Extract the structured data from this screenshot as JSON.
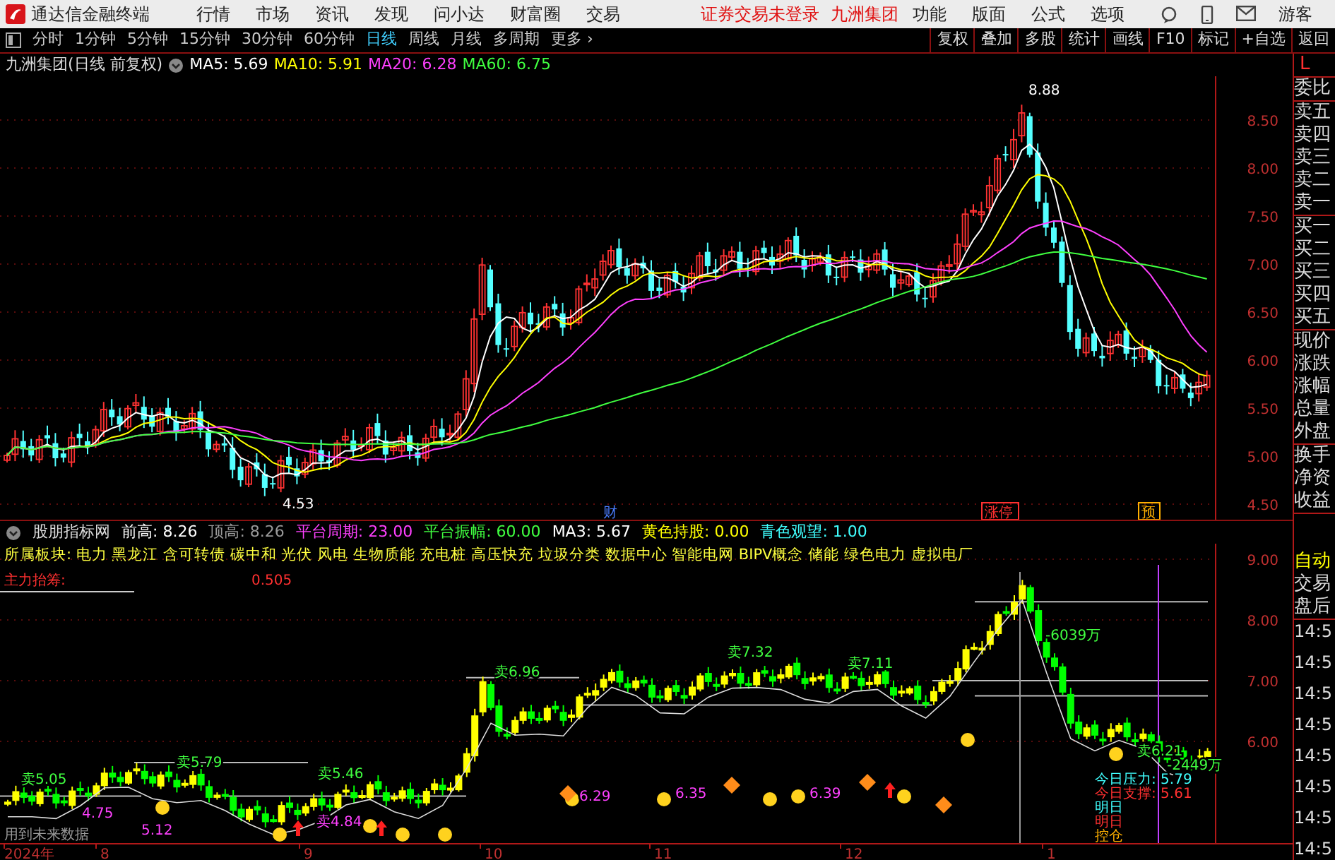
{
  "app_bar": {
    "title": "通达信金融终端",
    "menus": [
      "行情",
      "市场",
      "资讯",
      "发现",
      "问小达",
      "财富圈",
      "交易"
    ],
    "notice": "证券交易未登录",
    "stock": "九洲集团",
    "right_menus": [
      "功能",
      "版面",
      "公式",
      "选项"
    ],
    "user": "游客"
  },
  "period_bar": {
    "periods": [
      {
        "label": "分时",
        "selected": false
      },
      {
        "label": "1分钟",
        "selected": false
      },
      {
        "label": "5分钟",
        "selected": false
      },
      {
        "label": "15分钟",
        "selected": false
      },
      {
        "label": "30分钟",
        "selected": false
      },
      {
        "label": "60分钟",
        "selected": false
      },
      {
        "label": "日线",
        "selected": true
      },
      {
        "label": "周线",
        "selected": false
      },
      {
        "label": "月线",
        "selected": false
      },
      {
        "label": "多周期",
        "selected": false
      },
      {
        "label": "更多 ›",
        "selected": false
      }
    ],
    "tools": [
      "复权",
      "叠加",
      "多股",
      "统计",
      "画线",
      "F10",
      "标记",
      "+自选",
      "返回"
    ]
  },
  "chart_header": {
    "title": "九洲集团(日线 前复权)",
    "averages": [
      {
        "label": "MA5:",
        "value": "5.69",
        "color": "#ffffff"
      },
      {
        "label": "MA10:",
        "value": "5.91",
        "color": "#ffff00"
      },
      {
        "label": "MA20:",
        "value": "6.28",
        "color": "#ff40ff"
      },
      {
        "label": "MA60:",
        "value": "6.75",
        "color": "#40ff40"
      }
    ]
  },
  "price_chart": {
    "axis_labels": [
      "8.50",
      "8.00",
      "7.50",
      "7.00",
      "6.50",
      "6.00",
      "5.50",
      "5.00",
      "4.50"
    ],
    "annotations": [
      {
        "text": "8.88",
        "kind": "plain",
        "color": "#ffffff"
      },
      {
        "text": "4.53",
        "kind": "plain",
        "color": "#ffffff"
      },
      {
        "text": "财",
        "kind": "plain",
        "color": "#4a7dff"
      },
      {
        "text": "涨停",
        "kind": "tag",
        "color": "#ff3030"
      },
      {
        "text": "预",
        "kind": "tag",
        "color": "#ffb000"
      }
    ]
  },
  "indicator": {
    "name": "股朋指标网",
    "stats": [
      {
        "label": "前高:",
        "value": "8.26",
        "color": "#ffffff"
      },
      {
        "label": "顶高:",
        "value": "8.26",
        "color": "#9a9a9a"
      },
      {
        "label": "平台周期:",
        "value": "23.00",
        "color": "#ff40ff"
      },
      {
        "label": "平台振幅:",
        "value": "60.00",
        "color": "#40ff40"
      },
      {
        "label": "MA3:",
        "value": "5.67",
        "color": "#ffffff"
      },
      {
        "label": "黄色持股:",
        "value": "0.00",
        "color": "#ffff00"
      },
      {
        "label": "青色观望:",
        "value": "1.00",
        "color": "#40ffff"
      }
    ],
    "sectors": "所属板块: 电力 黑龙江 含可转债 碳中和 光伏 风电 生物质能 充电桩 高压快充 垃圾分类 数据中心 智能电网 BIPV概念 储能 绿色电力 虚拟电厂",
    "axis_labels": [
      "9.00",
      "8.00",
      "7.00",
      "6.00"
    ],
    "annotations": [
      {
        "text": "主力抬筹:",
        "color": "#ff3030"
      },
      {
        "text": "卖5.05",
        "color": "#40ff40"
      },
      {
        "text": "4.75",
        "color": "#ff40ff"
      },
      {
        "text": "用到未来数据",
        "color": "#9a9a9a"
      },
      {
        "text": "5.12",
        "color": "#ff40ff"
      },
      {
        "text": "卖5.79",
        "color": "#40ff40"
      },
      {
        "text": "0.505",
        "color": "#ff3030"
      },
      {
        "text": "卖4.84",
        "color": "#ff40ff"
      },
      {
        "text": "卖5.46",
        "color": "#40ff40"
      },
      {
        "text": "卖6.96",
        "color": "#40ff40"
      },
      {
        "text": "6.29",
        "color": "#ff40ff"
      },
      {
        "text": "6.35",
        "color": "#ff40ff"
      },
      {
        "text": "卖7.32",
        "color": "#40ff40"
      },
      {
        "text": "6.39",
        "color": "#ff40ff"
      },
      {
        "text": "卖7.11",
        "color": "#40ff40"
      },
      {
        "text": "-6039万",
        "color": "#40ff40"
      },
      {
        "text": "今日压力: 5.79",
        "color": "#40ffff"
      },
      {
        "text": "今日支撑: 5.61",
        "color": "#ff3030"
      },
      {
        "text": "明日",
        "color": "#40ffff"
      },
      {
        "text": "明日",
        "color": "#ff3030"
      },
      {
        "text": "控仓",
        "color": "#ffb000"
      },
      {
        "text": "卖6.21",
        "color": "#40ff40"
      },
      {
        "text": "-2449万",
        "color": "#40ff40"
      }
    ]
  },
  "time_axis": [
    "2024年",
    "8",
    "9",
    "10",
    "11",
    "12",
    "1"
  ],
  "side_panel": {
    "mode": "L",
    "quote_groups": [
      [
        "委比"
      ],
      [
        "卖五",
        "卖四",
        "卖三",
        "卖二",
        "卖一"
      ],
      [
        "买一",
        "买二",
        "买三",
        "买四",
        "买五"
      ],
      [
        "现价",
        "涨跌",
        "涨幅",
        "总量",
        "外盘"
      ],
      [
        "换手",
        "净资",
        "收益"
      ]
    ],
    "status": [
      {
        "text": "自动",
        "highlighted": true
      },
      {
        "text": "交易",
        "highlighted": false
      },
      {
        "text": "盘后",
        "highlighted": false
      }
    ],
    "times": [
      "14:5",
      "14:5",
      "14:5",
      "14:5",
      "14:5",
      "14:5",
      "14:5",
      "14:5"
    ]
  }
}
